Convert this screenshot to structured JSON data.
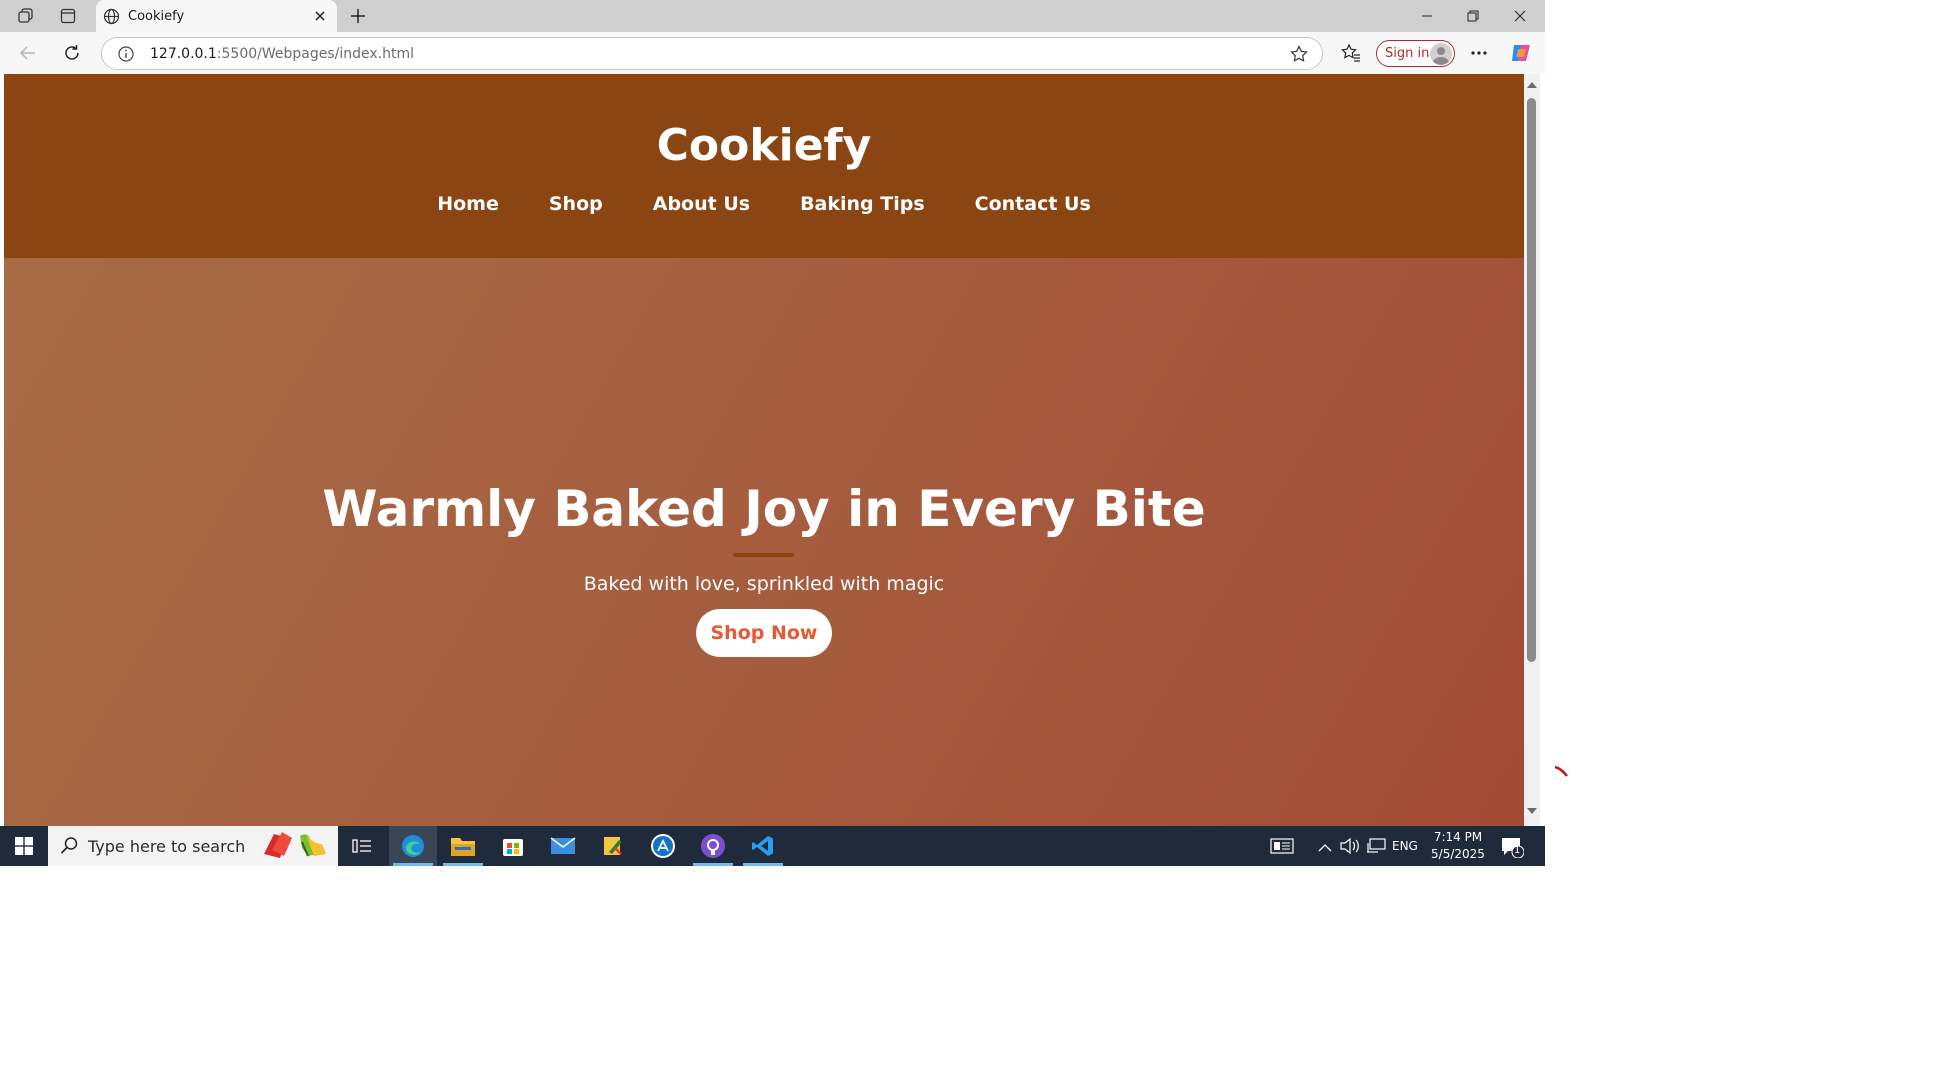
{
  "browser": {
    "tab_title": "Cookiefy",
    "url_host": "127.0.0.1",
    "url_path": ":5500/Webpages/index.html",
    "sign_in_label": "Sign in"
  },
  "site": {
    "brand": "Cookiefy",
    "nav": [
      "Home",
      "Shop",
      "About Us",
      "Baking Tips",
      "Contact Us"
    ],
    "hero_title": "Warmly Baked Joy in Every Bite",
    "hero_subtitle": "Baked with love, sprinkled with magic",
    "cta_label": "Shop Now",
    "colors": {
      "header": "#8b4513",
      "hero_start": "#a76b44",
      "hero_end": "#a24a34",
      "cta_text": "#e65a33"
    }
  },
  "taskbar": {
    "search_placeholder": "Type here to search",
    "language": "ENG",
    "time": "7:14 PM",
    "date": "5/5/2025",
    "notification_count": "1"
  }
}
